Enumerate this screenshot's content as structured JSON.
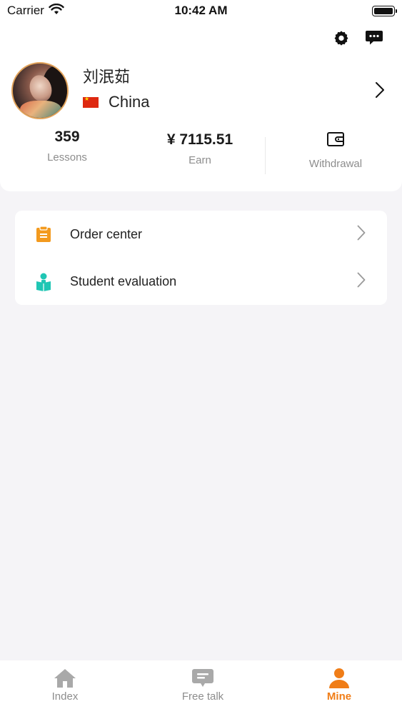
{
  "status_bar": {
    "carrier": "Carrier",
    "time": "10:42 AM"
  },
  "profile": {
    "name": "刘泯茹",
    "country": "China",
    "stats": {
      "lessons_value": "359",
      "lessons_label": "Lessons",
      "earn_value": "¥ 7115.51",
      "earn_label": "Earn",
      "withdraw_label": "Withdrawal"
    }
  },
  "menu": {
    "items": [
      {
        "label": "Order center",
        "icon": "clipboard-icon",
        "icon_color": "#f39a1e"
      },
      {
        "label": "Student evaluation",
        "icon": "student-reading-icon",
        "icon_color": "#20c6b4"
      }
    ]
  },
  "tab_bar": {
    "tabs": [
      {
        "label": "Index",
        "icon": "home-icon",
        "active": false
      },
      {
        "label": "Free talk",
        "icon": "chat-icon",
        "active": false
      },
      {
        "label": "Mine",
        "icon": "person-icon",
        "active": true
      }
    ],
    "active_color": "#f07d17",
    "inactive_color": "#a9a9a9"
  }
}
